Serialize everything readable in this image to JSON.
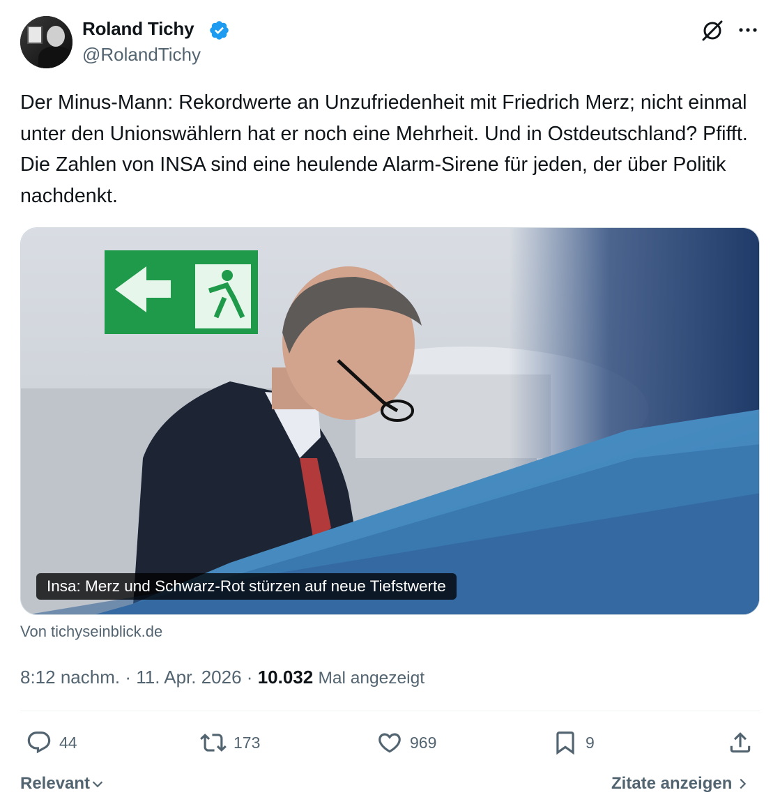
{
  "author": {
    "name": "Roland Tichy",
    "handle": "@RolandTichy",
    "verified": true
  },
  "tweet": {
    "text": "Der Minus-Mann: Rekordwerte an Unzufriedenheit mit Friedrich Merz; nicht einmal unter den Unionswählern hat er noch eine Mehrheit. Und in Ostdeutschland? Pfifft. Die Zahlen von INSA sind eine heulende Alarm-Sirene für jeden, der über Politik nachdenkt.",
    "link_card": {
      "caption": "Insa: Merz und Schwarz-Rot stürzen auf neue Tiefstwerte",
      "source": "Von tichyseinblick.de"
    },
    "time": "8:12 nachm.",
    "separator": "·",
    "date": "11. Apr. 2026",
    "views_count": "10.032",
    "views_label": "Mal angezeigt"
  },
  "actions": {
    "replies": "44",
    "reposts": "173",
    "likes": "969",
    "bookmarks": "9"
  },
  "footer": {
    "sort_label": "Relevant",
    "quotes_label": "Zitate anzeigen"
  },
  "colors": {
    "text": "#0f1419",
    "secondary": "#536471",
    "verified": "#1d9bf0",
    "divider": "#eff3f4"
  },
  "icons": [
    "verified-badge-icon",
    "grok-icon",
    "more-icon",
    "reply-icon",
    "repost-icon",
    "like-icon",
    "bookmark-icon",
    "share-icon",
    "chevron-down-icon",
    "chevron-right-icon"
  ]
}
